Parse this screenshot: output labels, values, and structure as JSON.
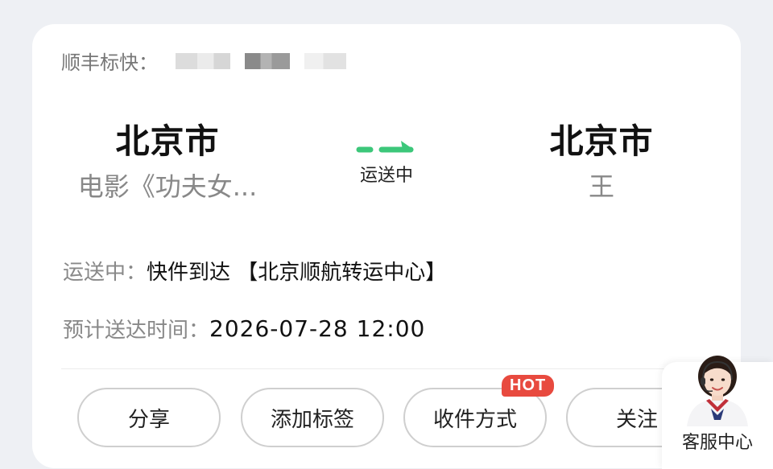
{
  "carrier": {
    "label": "顺丰标快："
  },
  "route": {
    "from": {
      "city": "北京市",
      "detail": "电影《功夫女..."
    },
    "status": "运送中",
    "to": {
      "city": "北京市",
      "detail": "王"
    }
  },
  "tracking": {
    "status_label": "运送中：",
    "status_value": "快件到达 【北京顺航转运中心】",
    "eta_label": "预计送达时间：",
    "eta_value": "2026-07-28 12:00"
  },
  "actions": {
    "share": "分享",
    "add_tag": "添加标签",
    "receive_method": "收件方式",
    "hot_badge": "HOT",
    "follow": "关注"
  },
  "customer_service": {
    "label": "客服中心"
  },
  "colors": {
    "accent_green": "#3cc77a",
    "hot_red": "#e84a3f"
  },
  "icons": {
    "route_arrow": "dashed-arrow-icon",
    "agent": "customer-service-agent-icon"
  }
}
